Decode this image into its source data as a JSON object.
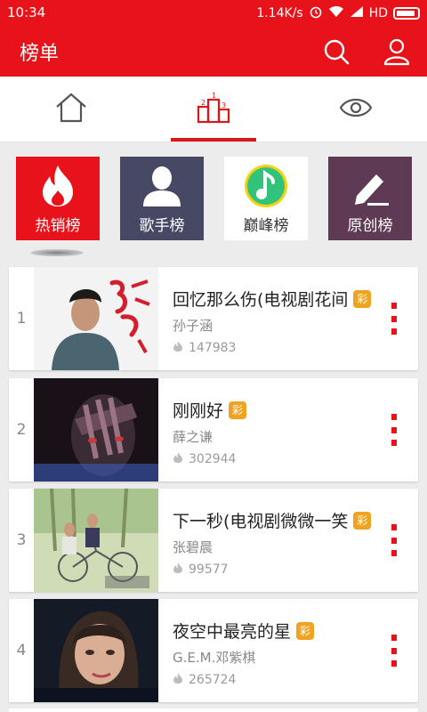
{
  "status": {
    "time": "10:34",
    "speed": "1.14K/s",
    "network": "HD"
  },
  "appbar": {
    "title": "榜单",
    "search_icon": "search-icon",
    "user_icon": "user-icon"
  },
  "tabs": [
    {
      "icon": "home-icon"
    },
    {
      "icon": "podium-icon",
      "selected": true
    },
    {
      "icon": "eye-icon"
    }
  ],
  "categories": [
    {
      "label": "热销榜",
      "icon": "flame-icon",
      "color": "#e8131a"
    },
    {
      "label": "歌手榜",
      "icon": "person-icon",
      "color": "#474964"
    },
    {
      "label": "巅峰榜",
      "icon": "qq-music-icon",
      "color": "#ffffff",
      "label_color": "#333333"
    },
    {
      "label": "原创榜",
      "icon": "pen-icon",
      "color": "#5e3a55"
    }
  ],
  "songs": [
    {
      "rank": "1",
      "title": "回忆那么伤(电视剧花间",
      "badge": "彩",
      "artist": "孙子涵",
      "plays": "147983"
    },
    {
      "rank": "2",
      "title": "刚刚好",
      "badge": "彩",
      "artist": "薛之谦",
      "plays": "302944"
    },
    {
      "rank": "3",
      "title": "下一秒(电视剧微微一笑",
      "badge": "彩",
      "artist": "张碧晨",
      "plays": "99577"
    },
    {
      "rank": "4",
      "title": "夜空中最亮的星",
      "badge": "彩",
      "artist": "G.E.M.邓紫棋",
      "plays": "265724"
    }
  ],
  "colors": {
    "accent": "#e8131a",
    "badge": "#f0a321"
  }
}
